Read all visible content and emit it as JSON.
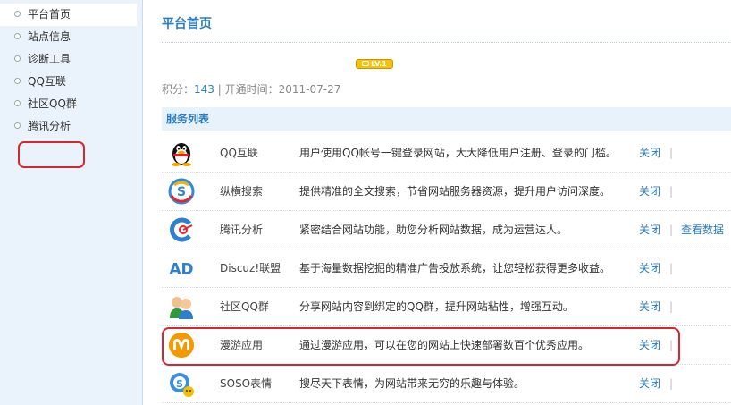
{
  "sidebar": {
    "items": [
      {
        "label": "平台首页"
      },
      {
        "label": "站点信息"
      },
      {
        "label": "诊断工具"
      },
      {
        "label": "QQ互联"
      },
      {
        "label": "社区QQ群"
      },
      {
        "label": "腾讯分析"
      }
    ]
  },
  "main": {
    "title": "平台首页",
    "level_badge": "LV.1",
    "stats": {
      "points_label": "积分：",
      "points": "143",
      "sep": "|",
      "open_label": "开通时间：",
      "open_date": "2011-07-27"
    },
    "services_header": "服务列表",
    "services": [
      {
        "icon": "qq-penguin-icon",
        "name": "QQ互联",
        "desc": "用户使用QQ帐号一键登录网站，大大降低用户注册、登录的门槛。",
        "close": "关闭",
        "sep": "|",
        "extra": ""
      },
      {
        "icon": "soso-search-icon",
        "name": "纵横搜索",
        "desc": "提供精准的全文搜索，节省网站服务器资源，提升用户访问深度。",
        "close": "关闭",
        "sep": "|",
        "extra": ""
      },
      {
        "icon": "analytics-icon",
        "name": "腾讯分析",
        "desc": "紧密结合网站功能，助您分析网站数据，成为运营达人。",
        "close": "关闭",
        "sep": "|",
        "extra": "查看数据"
      },
      {
        "icon": "ad-icon",
        "name": "Discuz!联盟",
        "desc": "基于海量数据挖掘的精准广告投放系统，让您轻松获得更多收益。",
        "close": "关闭",
        "sep": "|",
        "extra": ""
      },
      {
        "icon": "qq-group-icon",
        "name": "社区QQ群",
        "desc": "分享网站内容到绑定的QQ群，提升网站粘性，增强互动。",
        "close": "关闭",
        "sep": "|",
        "extra": ""
      },
      {
        "icon": "manyou-icon",
        "name": "漫游应用",
        "desc": "通过漫游应用，可以在您的网站上快速部署数百个优秀应用。",
        "close": "关闭",
        "sep": "|",
        "extra": ""
      },
      {
        "icon": "soso-emoticon-icon",
        "name": "SOSO表情",
        "desc": "搜尽天下表情，为网站带来无穷的乐趣与体验。",
        "close": "关闭",
        "sep": "|",
        "extra": ""
      }
    ]
  },
  "colors": {
    "accent": "#2b7cbf",
    "sidebar_bg": "#eaf3fb",
    "highlight_red": "#d8262e"
  }
}
